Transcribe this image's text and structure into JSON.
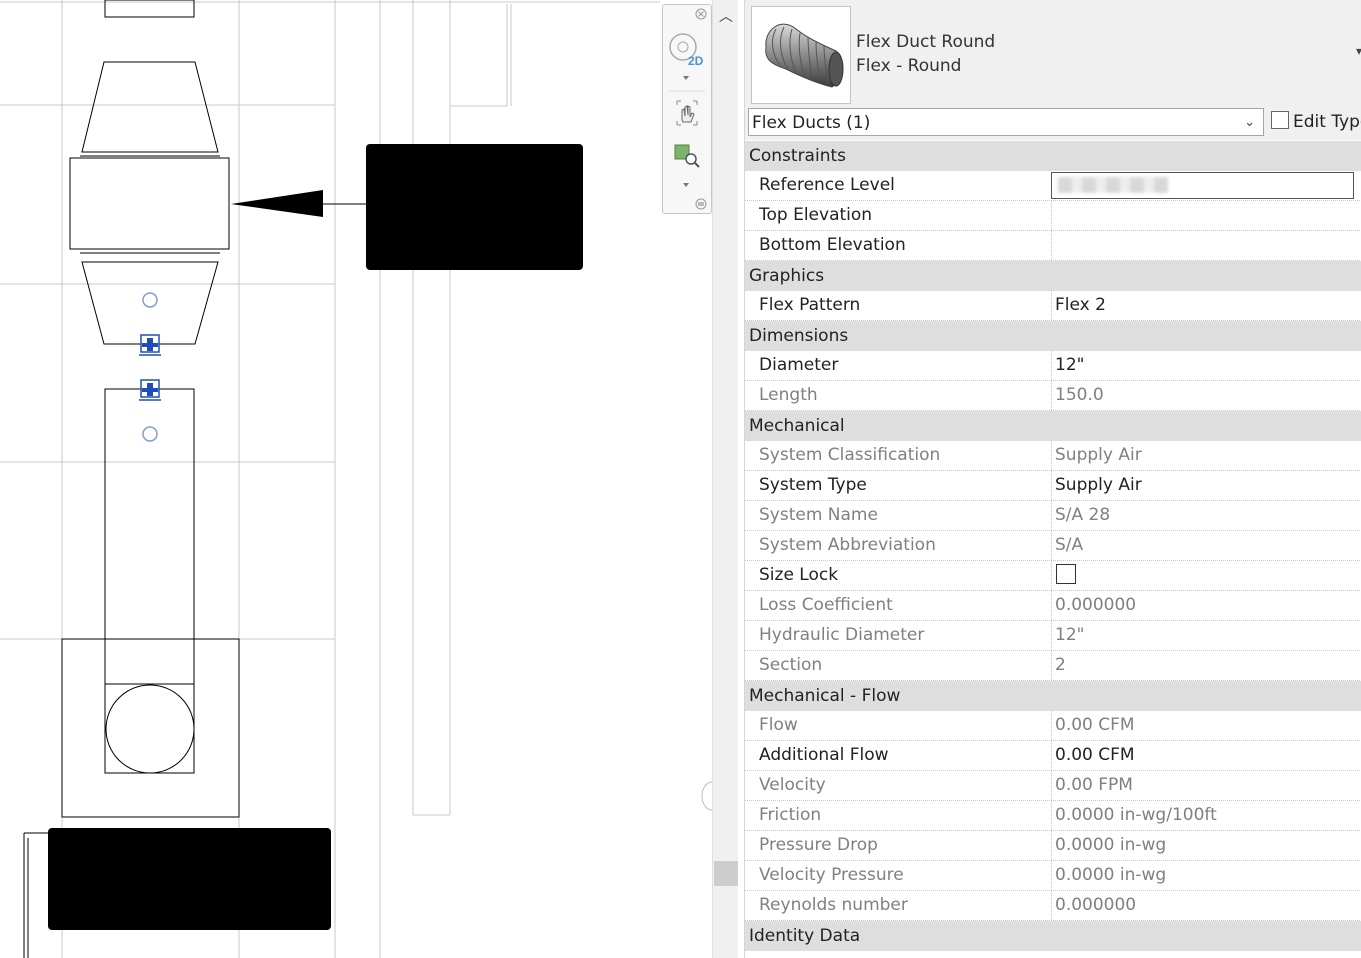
{
  "type_selector": {
    "family": "Flex Duct Round",
    "type": "Flex - Round",
    "thumbnail_icon": "flex-duct-icon"
  },
  "filter": {
    "value": "Flex Ducts (1)",
    "edit_type_label": "Edit Type"
  },
  "properties": [
    {
      "group": "Constraints",
      "rows": [
        {
          "name": "Reference Level",
          "value": "",
          "readonly": false,
          "special": "blurred"
        },
        {
          "name": "Top Elevation",
          "value": "",
          "readonly": false
        },
        {
          "name": "Bottom Elevation",
          "value": "",
          "readonly": false
        }
      ]
    },
    {
      "group": "Graphics",
      "rows": [
        {
          "name": "Flex Pattern",
          "value": "Flex 2",
          "readonly": false
        }
      ]
    },
    {
      "group": "Dimensions",
      "rows": [
        {
          "name": "Diameter",
          "value": "12\"",
          "readonly": false
        },
        {
          "name": "Length",
          "value": "150.0",
          "readonly": true
        }
      ]
    },
    {
      "group": "Mechanical",
      "rows": [
        {
          "name": "System Classification",
          "value": "Supply Air",
          "readonly": true
        },
        {
          "name": "System Type",
          "value": "Supply Air",
          "readonly": false
        },
        {
          "name": "System Name",
          "value": "S/A 28",
          "readonly": true
        },
        {
          "name": "System Abbreviation",
          "value": "S/A",
          "readonly": true
        },
        {
          "name": "Size Lock",
          "value": "",
          "readonly": false,
          "special": "checkbox",
          "checked": false
        },
        {
          "name": "Loss Coefficient",
          "value": "0.000000",
          "readonly": true
        },
        {
          "name": "Hydraulic Diameter",
          "value": "12\"",
          "readonly": true
        },
        {
          "name": "Section",
          "value": "2",
          "readonly": true
        }
      ]
    },
    {
      "group": "Mechanical - Flow",
      "rows": [
        {
          "name": "Flow",
          "value": "0.00 CFM",
          "readonly": true
        },
        {
          "name": "Additional Flow",
          "value": "0.00 CFM",
          "readonly": false
        },
        {
          "name": "Velocity",
          "value": "0.00 FPM",
          "readonly": true
        },
        {
          "name": "Friction",
          "value": "0.0000 in-wg/100ft",
          "readonly": true
        },
        {
          "name": "Pressure Drop",
          "value": "0.0000 in-wg",
          "readonly": true
        },
        {
          "name": "Velocity Pressure",
          "value": "0.0000 in-wg",
          "readonly": true
        },
        {
          "name": "Reynolds number",
          "value": "0.000000",
          "readonly": true
        }
      ]
    },
    {
      "group": "Identity Data",
      "rows": []
    }
  ],
  "view_bar": {
    "badge_2d": "2D",
    "icons": [
      "close-icon",
      "steering-wheel-icon",
      "pan-icon",
      "zoom-region-icon",
      "options-icon"
    ]
  },
  "colors": {
    "group_bg": "#dedede",
    "readonly_text": "#808080",
    "connector_blue": "#1f4fb6"
  }
}
